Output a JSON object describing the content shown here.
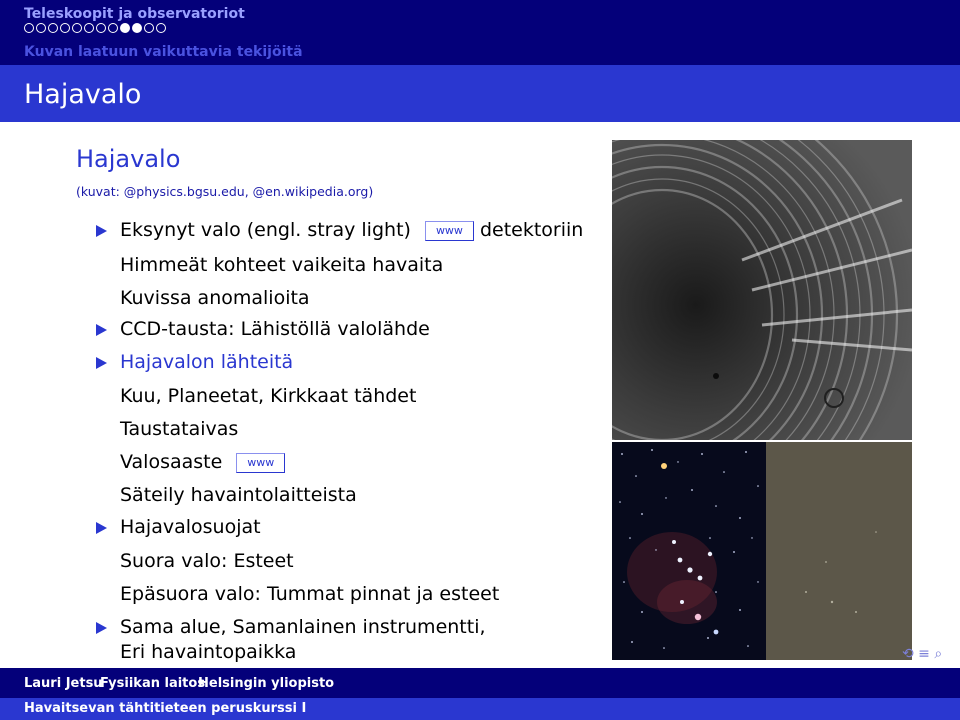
{
  "header": {
    "course_title": "Teleskoopit ja observatoriot",
    "section_title": "Kuvan laatuun vaikuttavia tekijöitä",
    "progress_dots": [
      false,
      false,
      false,
      false,
      false,
      false,
      false,
      false,
      true,
      true,
      false,
      false
    ],
    "frame_title": "Hajavalo"
  },
  "block": {
    "title": "Hajavalo",
    "credit": "(kuvat: @physics.bgsu.edu, @en.wikipedia.org)"
  },
  "items": {
    "item1_before": "Eksynyt  valo  (engl. stray light)",
    "item1_link": "www",
    "item1_after": "detektoriin",
    "sub1": "Himmeät kohteet vaikeita havaita",
    "sub2": "Kuvissa anomalioita",
    "item2": "CCD-tausta: Lähistöllä valolähde",
    "item3": "Hajavalon lähteitä",
    "sub3": "Kuu, Planeetat, Kirkkaat tähdet",
    "sub4": "Taustataivas",
    "sub5": "Valosaaste",
    "sub5_link": "www",
    "sub6": "Säteily havaintolaitteista",
    "item4": "Hajavalosuojat",
    "sub7": "Suora valo: Esteet",
    "sub8": "Epäsuora valo: Tummat pinnat ja esteet",
    "item5_line1": "Sama alue, Samanlainen instrumentti,",
    "item5_line2": "Eri havaintopaikka"
  },
  "footer": {
    "author": "Lauri Jetsu",
    "department": "Fysiikan laitos",
    "university": "Helsingin yliopisto",
    "course": "Havaitsevan tähtitieteen peruskurssi I"
  },
  "colors": {
    "dark_bar": "#04007a",
    "accent": "#2a37d0"
  }
}
